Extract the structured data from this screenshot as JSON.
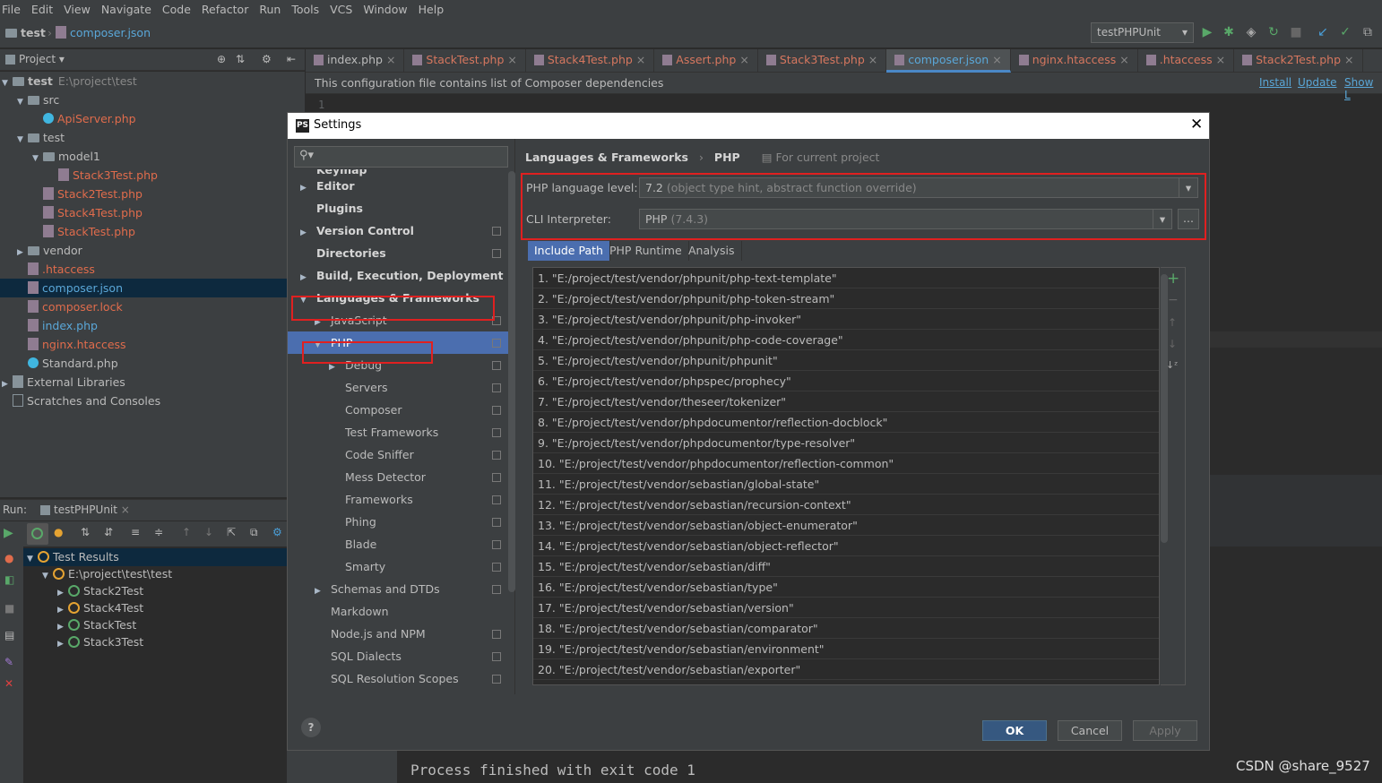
{
  "menu": [
    "File",
    "Edit",
    "View",
    "Navigate",
    "Code",
    "Refactor",
    "Run",
    "Tools",
    "VCS",
    "Window",
    "Help"
  ],
  "nav": {
    "crumb_project": "test",
    "crumb_file": "composer.json",
    "run_config": "testPHPUnit"
  },
  "project_panel": {
    "title": "Project",
    "tree": [
      {
        "label": "test",
        "extra": "E:\\project\\test",
        "kind": "folder",
        "depth": 0,
        "bold": true
      },
      {
        "label": "src",
        "kind": "folder",
        "depth": 1
      },
      {
        "label": "ApiServer.php",
        "kind": "php",
        "depth": 2,
        "color": "red"
      },
      {
        "label": "test",
        "kind": "folder",
        "depth": 1
      },
      {
        "label": "model1",
        "kind": "folder",
        "depth": 2
      },
      {
        "label": "Stack3Test.php",
        "kind": "file",
        "depth": 3,
        "color": "red"
      },
      {
        "label": "Stack2Test.php",
        "kind": "file",
        "depth": 2,
        "color": "red"
      },
      {
        "label": "Stack4Test.php",
        "kind": "file",
        "depth": 2,
        "color": "red"
      },
      {
        "label": "StackTest.php",
        "kind": "file",
        "depth": 2,
        "color": "red"
      },
      {
        "label": "vendor",
        "kind": "folder",
        "depth": 1
      },
      {
        "label": ".htaccess",
        "kind": "file",
        "depth": 1,
        "color": "red"
      },
      {
        "label": "composer.json",
        "kind": "file",
        "depth": 1,
        "color": "blue",
        "selected": true
      },
      {
        "label": "composer.lock",
        "kind": "file",
        "depth": 1,
        "color": "red"
      },
      {
        "label": "index.php",
        "kind": "file",
        "depth": 1,
        "color": "blue"
      },
      {
        "label": "nginx.htaccess",
        "kind": "file",
        "depth": 1,
        "color": "red"
      },
      {
        "label": "Standard.php",
        "kind": "php",
        "depth": 1
      },
      {
        "label": "External Libraries",
        "kind": "lib",
        "depth": 0
      },
      {
        "label": "Scratches and Consoles",
        "kind": "scratch",
        "depth": 0
      }
    ]
  },
  "editor": {
    "tabs": [
      "index.php",
      "StackTest.php",
      "Stack4Test.php",
      "Assert.php",
      "Stack3Test.php",
      "composer.json",
      "nginx.htaccess",
      ".htaccess",
      "Stack2Test.php"
    ],
    "active_tab": 5,
    "banner": "This configuration file contains list of Composer dependencies",
    "banner_links": [
      "Install",
      "Update",
      "Show L"
    ]
  },
  "run_panel": {
    "label": "Run:",
    "config": "testPHPUnit",
    "tree": [
      {
        "label": "Test Results",
        "status": "warn",
        "depth": 0
      },
      {
        "label": "E:\\project\\test\\test",
        "status": "warn",
        "depth": 1
      },
      {
        "label": "Stack2Test",
        "status": "ok",
        "depth": 2
      },
      {
        "label": "Stack4Test",
        "status": "warn",
        "depth": 2
      },
      {
        "label": "StackTest",
        "status": "ok",
        "depth": 2
      },
      {
        "label": "Stack3Test",
        "status": "ok",
        "depth": 2
      }
    ]
  },
  "console": {
    "text": "Process finished with exit code 1"
  },
  "watermark": "CSDN @share_9527",
  "settings_dialog": {
    "title": "Settings",
    "search_placeholder": "",
    "nav": [
      {
        "label": "Keymap",
        "depth": 0,
        "bold": true,
        "partial": true
      },
      {
        "label": "Editor",
        "depth": 0,
        "bold": true,
        "expandable": true
      },
      {
        "label": "Plugins",
        "depth": 0,
        "bold": true
      },
      {
        "label": "Version Control",
        "depth": 0,
        "bold": true,
        "expandable": true,
        "copy": true
      },
      {
        "label": "Directories",
        "depth": 0,
        "bold": true,
        "copy": true
      },
      {
        "label": "Build, Execution, Deployment",
        "depth": 0,
        "bold": true,
        "expandable": true
      },
      {
        "label": "Languages & Frameworks",
        "depth": 0,
        "bold": true,
        "expanded": true
      },
      {
        "label": "JavaScript",
        "depth": 1,
        "expandable": true,
        "copy": true
      },
      {
        "label": "PHP",
        "depth": 1,
        "expanded": true,
        "copy": true,
        "selected": true
      },
      {
        "label": "Debug",
        "depth": 2,
        "expandable": true,
        "copy": true
      },
      {
        "label": "Servers",
        "depth": 2,
        "copy": true
      },
      {
        "label": "Composer",
        "depth": 2,
        "copy": true
      },
      {
        "label": "Test Frameworks",
        "depth": 2,
        "copy": true
      },
      {
        "label": "Code Sniffer",
        "depth": 2,
        "copy": true
      },
      {
        "label": "Mess Detector",
        "depth": 2,
        "copy": true
      },
      {
        "label": "Frameworks",
        "depth": 2,
        "copy": true
      },
      {
        "label": "Phing",
        "depth": 2,
        "copy": true
      },
      {
        "label": "Blade",
        "depth": 2,
        "copy": true
      },
      {
        "label": "Smarty",
        "depth": 2,
        "copy": true
      },
      {
        "label": "Schemas and DTDs",
        "depth": 1,
        "expandable": true,
        "copy": true
      },
      {
        "label": "Markdown",
        "depth": 1
      },
      {
        "label": "Node.js and NPM",
        "depth": 1,
        "copy": true
      },
      {
        "label": "SQL Dialects",
        "depth": 1,
        "copy": true
      },
      {
        "label": "SQL Resolution Scopes",
        "depth": 1,
        "copy": true
      }
    ],
    "breadcrumb": [
      "Languages & Frameworks",
      "PHP"
    ],
    "scope_note": "For current project",
    "php_level_label": "PHP language level:",
    "php_level_value": "7.2",
    "php_level_hint": "(object type hint, abstract function override)",
    "cli_label": "CLI Interpreter:",
    "cli_value": "PHP",
    "cli_hint": "(7.4.3)",
    "cli_more": "...",
    "tabs": [
      "Include Path",
      "PHP Runtime",
      "Analysis"
    ],
    "active_tab": 0,
    "include_paths": [
      "1. \"E:/project/test/vendor/phpunit/php-text-template\"",
      "2. \"E:/project/test/vendor/phpunit/php-token-stream\"",
      "3. \"E:/project/test/vendor/phpunit/php-invoker\"",
      "4. \"E:/project/test/vendor/phpunit/php-code-coverage\"",
      "5. \"E:/project/test/vendor/phpunit/phpunit\"",
      "6. \"E:/project/test/vendor/phpspec/prophecy\"",
      "7. \"E:/project/test/vendor/theseer/tokenizer\"",
      "8. \"E:/project/test/vendor/phpdocumentor/reflection-docblock\"",
      "9. \"E:/project/test/vendor/phpdocumentor/type-resolver\"",
      "10. \"E:/project/test/vendor/phpdocumentor/reflection-common\"",
      "11. \"E:/project/test/vendor/sebastian/global-state\"",
      "12. \"E:/project/test/vendor/sebastian/recursion-context\"",
      "13. \"E:/project/test/vendor/sebastian/object-enumerator\"",
      "14. \"E:/project/test/vendor/sebastian/object-reflector\"",
      "15. \"E:/project/test/vendor/sebastian/diff\"",
      "16. \"E:/project/test/vendor/sebastian/type\"",
      "17. \"E:/project/test/vendor/sebastian/version\"",
      "18. \"E:/project/test/vendor/sebastian/comparator\"",
      "19. \"E:/project/test/vendor/sebastian/environment\"",
      "20. \"E:/project/test/vendor/sebastian/exporter\""
    ],
    "buttons": {
      "ok": "OK",
      "cancel": "Cancel",
      "apply": "Apply"
    },
    "help": "?"
  },
  "colors": {
    "accent": "#4b6eaf",
    "highlight_box": "#e02020",
    "ok_green": "#59a869",
    "warn": "#e5a332"
  }
}
